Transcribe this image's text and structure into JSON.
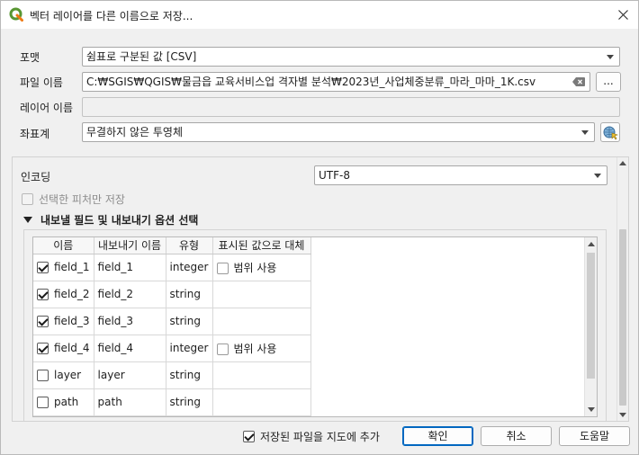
{
  "window": {
    "title": "벡터 레이어를 다른 이름으로 저장..."
  },
  "form": {
    "format_label": "포맷",
    "format_value": "쉼표로 구분된 값 [CSV]",
    "filename_label": "파일 이름",
    "filename_value": "C:₩SGIS₩QGIS₩물금읍 교육서비스업 격자별 분석₩2023년_사업체중분류_마라_마마_1K.csv",
    "browse_label": "...",
    "layername_label": "레이어 이름",
    "layername_value": "",
    "crs_label": "좌표계",
    "crs_value": "무결하지 않은 투영체"
  },
  "options": {
    "encoding_label": "인코딩",
    "encoding_value": "UTF-8",
    "selected_only_label": "선택한 피처만 저장",
    "section_title": "내보낼 필드 및 내보내기 옵션 선택"
  },
  "fields_table": {
    "columns": [
      "이름",
      "내보내기 이름",
      "유형",
      "표시된 값으로 대체"
    ],
    "rows": [
      {
        "checked": true,
        "name": "field_1",
        "export_name": "field_1",
        "type": "integer",
        "replace_checkbox": true,
        "replace_label": "범위 사용"
      },
      {
        "checked": true,
        "name": "field_2",
        "export_name": "field_2",
        "type": "string",
        "replace_checkbox": false,
        "replace_label": ""
      },
      {
        "checked": true,
        "name": "field_3",
        "export_name": "field_3",
        "type": "string",
        "replace_checkbox": false,
        "replace_label": ""
      },
      {
        "checked": true,
        "name": "field_4",
        "export_name": "field_4",
        "type": "integer",
        "replace_checkbox": true,
        "replace_label": "범위 사용"
      },
      {
        "checked": false,
        "name": "layer",
        "export_name": "layer",
        "type": "string",
        "replace_checkbox": false,
        "replace_label": ""
      },
      {
        "checked": false,
        "name": "path",
        "export_name": "path",
        "type": "string",
        "replace_checkbox": false,
        "replace_label": ""
      }
    ]
  },
  "footer": {
    "add_to_map_label": "저장된 파일을 지도에 추가",
    "ok_label": "확인",
    "cancel_label": "취소",
    "help_label": "도움말"
  },
  "colors": {
    "accent": "#0067c0",
    "qgis_green": "#589632",
    "qgis_yellow": "#ee7913"
  },
  "icons": {
    "app": "qgis-logo-icon",
    "close": "close-icon",
    "clear": "clear-text-icon",
    "crs": "globe-crs-icon"
  }
}
